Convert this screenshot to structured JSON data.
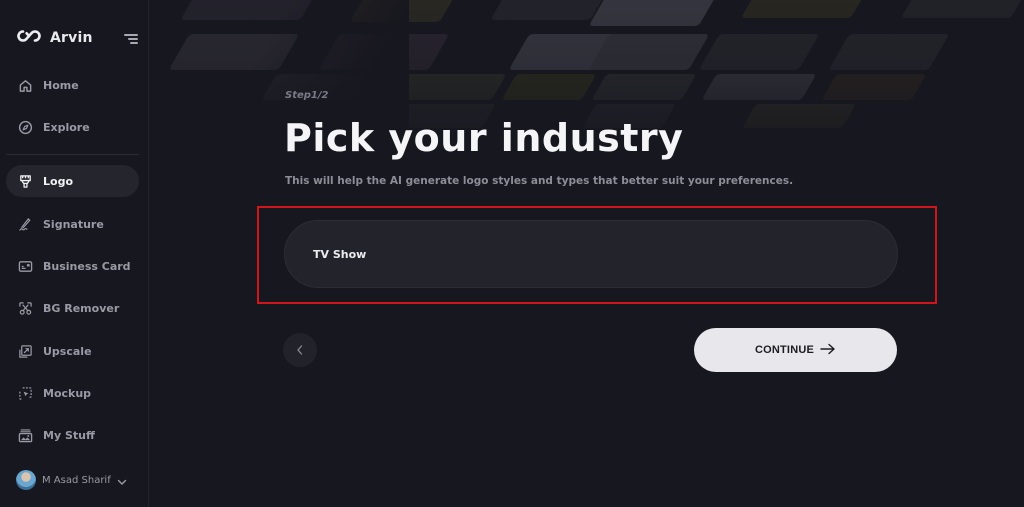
{
  "brand": {
    "name": "Arvin",
    "logo_icon": "infinity-logo-icon"
  },
  "sidebar": {
    "toggle_icon": "menu-toggle-icon",
    "items": [
      {
        "label": "Home",
        "icon": "home-icon",
        "active": false
      },
      {
        "label": "Explore",
        "icon": "compass-icon",
        "active": false
      },
      {
        "label": "Logo",
        "icon": "brush-icon",
        "active": true
      },
      {
        "label": "Signature",
        "icon": "signature-icon",
        "active": false
      },
      {
        "label": "Business Card",
        "icon": "business-card-icon",
        "active": false
      },
      {
        "label": "BG Remover",
        "icon": "scissors-icon",
        "active": false
      },
      {
        "label": "Upscale",
        "icon": "upscale-icon",
        "active": false
      },
      {
        "label": "Mockup",
        "icon": "mockup-icon",
        "active": false
      },
      {
        "label": "My Stuff",
        "icon": "image-folder-icon",
        "active": false
      }
    ],
    "user": {
      "name": "M Asad Sharif",
      "menu_icon": "chevron-down-icon"
    }
  },
  "main": {
    "step": "Step1/2",
    "title": "Pick your industry",
    "subtitle": "This will help the AI generate logo styles and types that better suit your preferences.",
    "industry_field": {
      "value": "TV Show"
    },
    "back_button": {
      "icon": "chevron-left-icon"
    },
    "continue_button": {
      "label": "CONTINUE",
      "icon": "arrow-right-icon"
    }
  },
  "colors": {
    "background": "#17171f",
    "field_background": "#23232b",
    "highlight_border": "#d0161b",
    "continue_background": "#e8e8ec"
  }
}
